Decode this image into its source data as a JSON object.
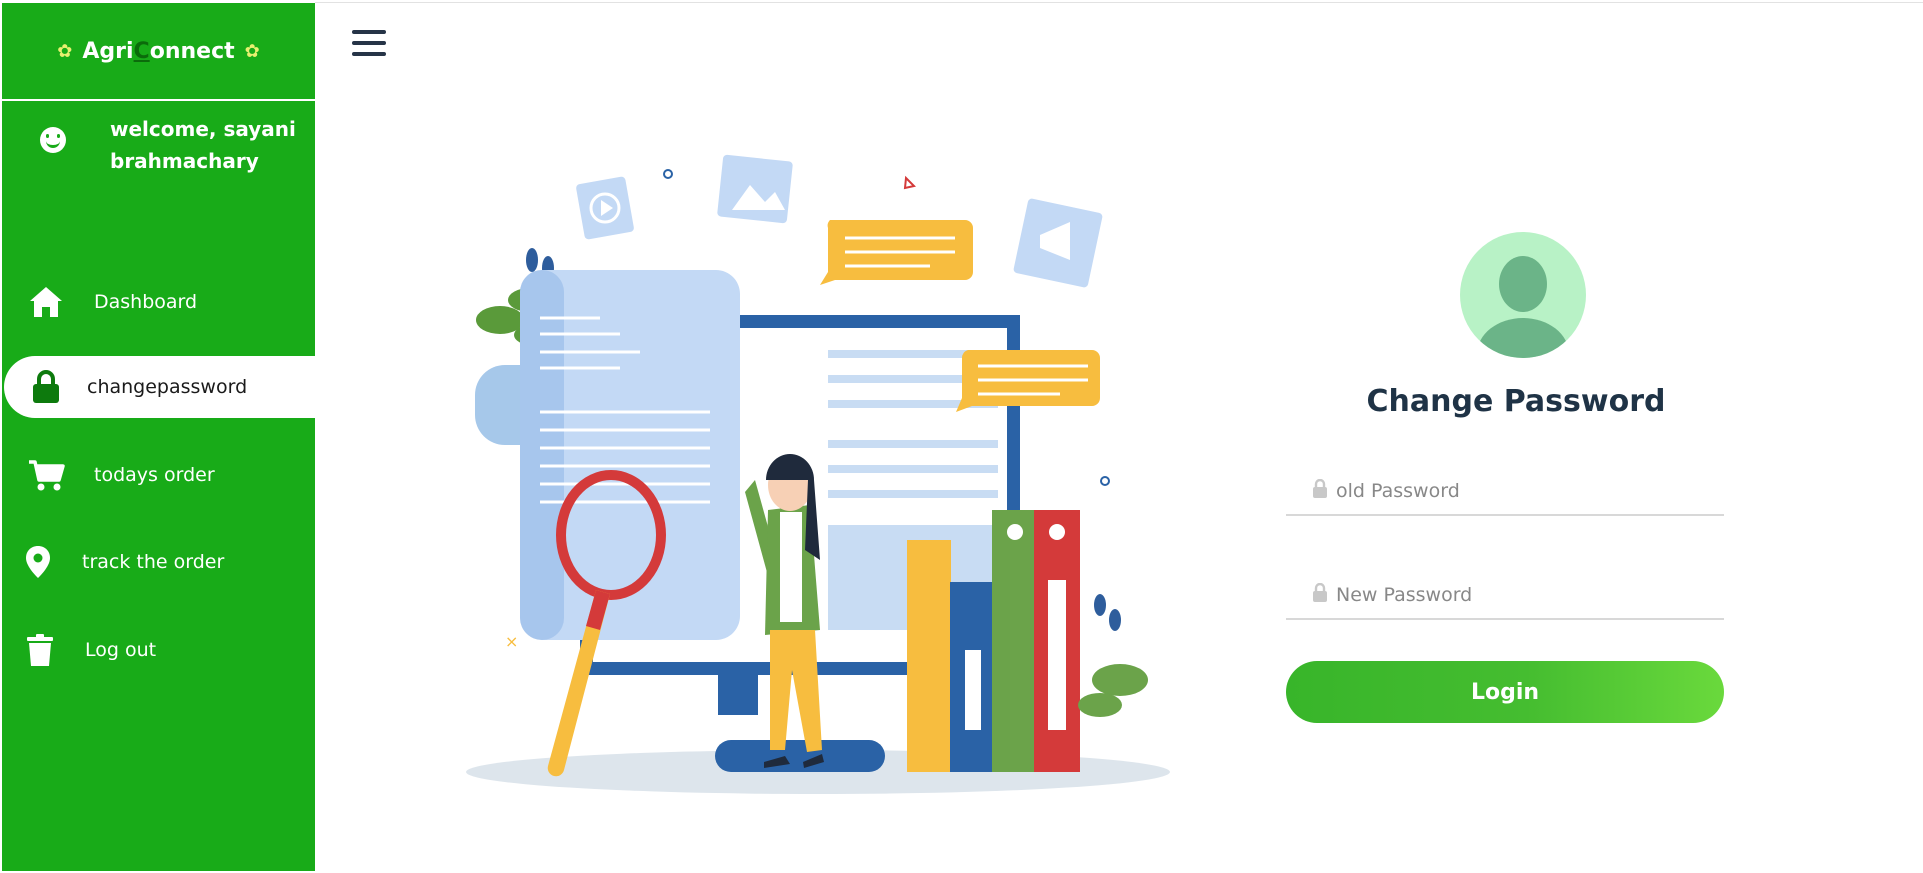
{
  "app": {
    "brand_left": "Agri",
    "brand_c": "C",
    "brand_right": "onnect"
  },
  "user": {
    "welcome_line1": "welcome, sayani",
    "welcome_line2": "brahmachary"
  },
  "sidebar": {
    "items": [
      {
        "label": "Dashboard",
        "icon": "home-icon"
      },
      {
        "label": "changepassword",
        "icon": "lock-icon",
        "active": true
      },
      {
        "label": "todays order",
        "icon": "cart-icon"
      },
      {
        "label": "track the order",
        "icon": "location-pin-icon"
      },
      {
        "label": "Log out",
        "icon": "trash-icon"
      }
    ]
  },
  "form": {
    "title": "Change Password",
    "old_password_placeholder": "old Password",
    "new_password_placeholder": "New Password",
    "submit_label": "Login"
  },
  "colors": {
    "sidebar_bg": "#18ab18",
    "title": "#1f3346",
    "button_start": "#38b52a",
    "button_end": "#6ad93c",
    "avatar_bg": "#b8f2c6"
  }
}
